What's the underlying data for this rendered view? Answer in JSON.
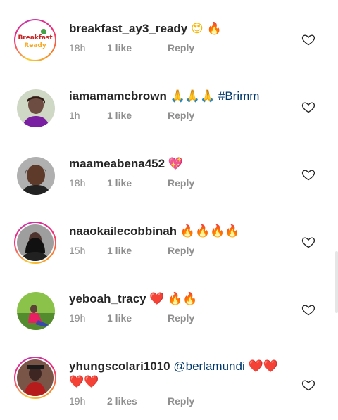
{
  "comments": [
    {
      "username": "breakfast_ay3_ready",
      "text_parts": [
        {
          "type": "emoji",
          "value": "😍",
          "style": "eyes"
        },
        {
          "type": "emoji",
          "value": "🔥",
          "style": "fire"
        }
      ],
      "time": "18h",
      "likes": "1 like",
      "reply": "Reply",
      "avatar": "logo",
      "avatar_ring": true
    },
    {
      "username": "iamamamcbrown",
      "text_parts": [
        {
          "type": "emoji",
          "value": "🙏🙏🙏",
          "style": "pray"
        },
        {
          "type": "hashtag",
          "value": "#Brimm"
        }
      ],
      "time": "1h",
      "likes": "1 like",
      "reply": "Reply",
      "avatar": "photo",
      "avatar_ring": false
    },
    {
      "username": "maameabena452",
      "text_parts": [
        {
          "type": "emoji",
          "value": "💖",
          "style": "sparkle"
        }
      ],
      "time": "18h",
      "likes": "1 like",
      "reply": "Reply",
      "avatar": "photo",
      "avatar_ring": false
    },
    {
      "username": "naaokailecobbinah",
      "text_parts": [
        {
          "type": "emoji",
          "value": "🔥🔥🔥🔥",
          "style": "fire"
        }
      ],
      "time": "15h",
      "likes": "1 like",
      "reply": "Reply",
      "avatar": "photo",
      "avatar_ring": true
    },
    {
      "username": "yeboah_tracy",
      "text_parts": [
        {
          "type": "emoji",
          "value": "❤️",
          "style": "heart"
        },
        {
          "type": "emoji",
          "value": "🔥🔥",
          "style": "fire"
        }
      ],
      "time": "19h",
      "likes": "1 like",
      "reply": "Reply",
      "avatar": "photo",
      "avatar_ring": false
    },
    {
      "username": "yhungscolari1010",
      "text_parts": [
        {
          "type": "mention",
          "value": "@berlamundi"
        },
        {
          "type": "emoji",
          "value": "❤️❤️❤️❤️",
          "style": "heart"
        }
      ],
      "time": "19h",
      "likes": "2 likes",
      "reply": "Reply",
      "avatar": "photo",
      "avatar_ring": true
    }
  ],
  "icons": {
    "like": "heart-outline-icon"
  },
  "colors": {
    "link": "#00376b",
    "meta": "#8e8e8e",
    "text": "#262626"
  }
}
